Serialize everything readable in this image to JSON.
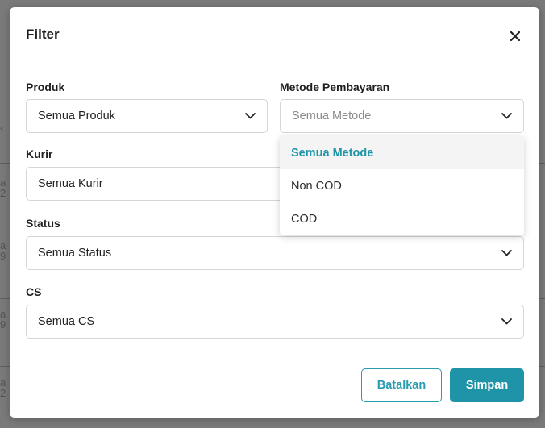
{
  "modal": {
    "title": "Filter",
    "close_icon": "close-icon"
  },
  "fields": {
    "produk": {
      "label": "Produk",
      "value": "Semua Produk"
    },
    "metode": {
      "label": "Metode Pembayaran",
      "placeholder": "Semua Metode"
    },
    "kurir": {
      "label": "Kurir",
      "value": "Semua Kurir"
    },
    "status": {
      "label": "Status",
      "value": "Semua Status"
    },
    "cs": {
      "label": "CS",
      "value": "Semua CS"
    }
  },
  "dropdown": {
    "options": [
      "Semua Metode",
      "Non COD",
      "COD"
    ],
    "selected_index": 0
  },
  "actions": {
    "cancel_label": "Batalkan",
    "save_label": "Simpan"
  },
  "colors": {
    "accent": "#1f93a8",
    "selected_text": "#2096a8",
    "overlay": "#7a7a7a"
  }
}
